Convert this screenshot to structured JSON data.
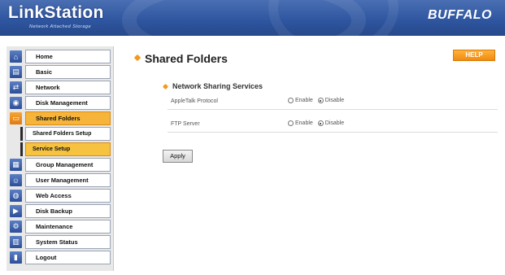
{
  "header": {
    "logo_title": "LinkStation",
    "logo_subtitle": "Network Attached Storage",
    "brand": "BUFFALO"
  },
  "sidebar": {
    "items": [
      {
        "label": "Home",
        "icon": "home-icon"
      },
      {
        "label": "Basic",
        "icon": "basic-icon"
      },
      {
        "label": "Network",
        "icon": "network-icon"
      },
      {
        "label": "Disk Management",
        "icon": "disk-icon"
      },
      {
        "label": "Shared Folders",
        "icon": "folder-icon",
        "active": true
      },
      {
        "label": "Group Management",
        "icon": "group-icon"
      },
      {
        "label": "User Management",
        "icon": "user-icon"
      },
      {
        "label": "Web Access",
        "icon": "web-icon"
      },
      {
        "label": "Disk Backup",
        "icon": "backup-icon"
      },
      {
        "label": "Maintenance",
        "icon": "maintenance-icon"
      },
      {
        "label": "System Status",
        "icon": "status-icon"
      },
      {
        "label": "Logout",
        "icon": "logout-icon"
      }
    ],
    "subitems": [
      {
        "label": "Shared Folders Setup"
      },
      {
        "label": "Service Setup",
        "active": true
      }
    ]
  },
  "main": {
    "page_title": "Shared Folders",
    "help_label": "HELP",
    "section_title": "Network Sharing Services",
    "settings": [
      {
        "label": "AppleTalk Protocol",
        "enable_label": "Enable",
        "disable_label": "Disable",
        "selected": "Disable"
      },
      {
        "label": "FTP Server",
        "enable_label": "Enable",
        "disable_label": "Disable",
        "selected": "Disable"
      }
    ],
    "apply_label": "Apply"
  },
  "colors": {
    "header_blue": "#2f56a0",
    "accent_orange": "#f39a1a",
    "active_nav": "#f6b53a"
  }
}
